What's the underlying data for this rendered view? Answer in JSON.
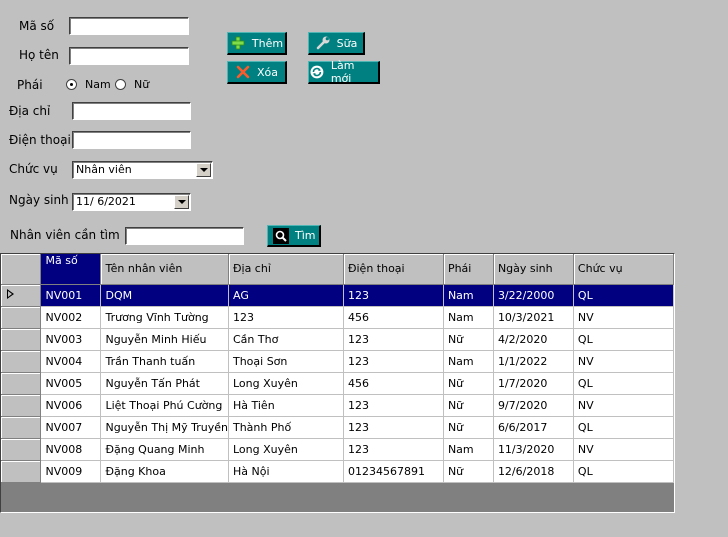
{
  "form": {
    "ma_so_label": "Mã số",
    "ho_ten_label": "Họ tên",
    "phai_label": "Phái",
    "nam_label": "Nam",
    "nu_label": "Nữ",
    "dia_chi_label": "Địa chỉ",
    "dien_thoai_label": "Điện thoại",
    "chuc_vu_label": "Chức vụ",
    "chuc_vu_value": "Nhân viên",
    "ngay_sinh_label": "Ngày sinh",
    "ngay_sinh_value": "11/ 6/2021",
    "search_label": "Nhân viên cần tìm",
    "ma_so_value": "",
    "ho_ten_value": "",
    "dia_chi_value": "",
    "dien_thoai_value": "",
    "search_value": ""
  },
  "buttons": {
    "them": "Thêm",
    "sua": "Sữa",
    "xoa": "Xóa",
    "lam_moi": "Làm mới",
    "tim": "Tìm"
  },
  "grid": {
    "headers": [
      "Mã số",
      "Tên nhân viên",
      "Địa chỉ",
      "Điện thoại",
      "Phái",
      "Ngày sinh",
      "Chức vụ"
    ],
    "rows": [
      [
        "NV001",
        "DQM",
        "AG",
        "123",
        "Nam",
        "3/22/2000",
        "QL"
      ],
      [
        "NV002",
        "Trương Vĩnh Tường",
        "123",
        "456",
        "Nam",
        "10/3/2021",
        "NV"
      ],
      [
        "NV003",
        "Nguyễn Minh Hiếu",
        "Cần Thơ",
        "123",
        "Nữ",
        "4/2/2020",
        "QL"
      ],
      [
        "NV004",
        "Trần Thanh tuấn",
        "Thoại Sơn",
        "123",
        "Nam",
        "1/1/2022",
        "NV"
      ],
      [
        "NV005",
        "Nguyễn Tấn Phát",
        "Long Xuyên",
        "456",
        "Nữ",
        "1/7/2020",
        "QL"
      ],
      [
        "NV006",
        "Liệt Thoại Phú Cường",
        "Hà Tiên",
        "123",
        "Nữ",
        "9/7/2020",
        "NV"
      ],
      [
        "NV007",
        "Nguyễn Thị Mỹ Truyền",
        "Thành Phố",
        "123",
        "Nữ",
        "6/6/2017",
        "QL"
      ],
      [
        "NV008",
        "Đặng Quang Minh",
        "Long Xuyên",
        "123",
        "Nam",
        "11/3/2020",
        "NV"
      ],
      [
        "NV009",
        "Đặng Khoa",
        "Hà Nội",
        "01234567891",
        "Nữ",
        "12/6/2018",
        "QL"
      ]
    ],
    "selected_row": 0
  },
  "colors": {
    "background": "#c0c0c0",
    "button": "#008080",
    "selection": "#000080"
  },
  "icons": {
    "them": "plus-icon",
    "sua": "wrench-icon",
    "xoa": "x-icon",
    "lam_moi": "refresh-icon",
    "tim": "magnifier-icon"
  }
}
